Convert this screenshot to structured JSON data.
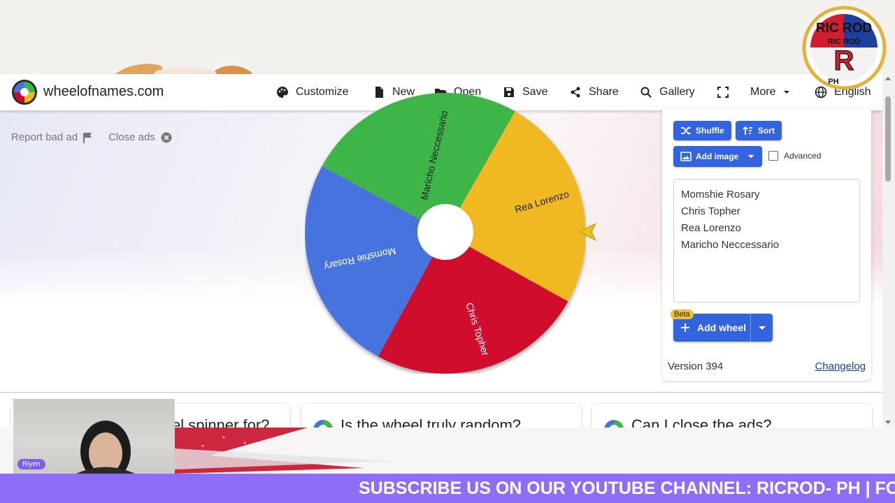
{
  "site": {
    "title": "wheelofnames.com"
  },
  "nav": {
    "customize": "Customize",
    "new": "New",
    "open": "Open",
    "save": "Save",
    "share": "Share",
    "gallery": "Gallery",
    "more": "More",
    "language": "English"
  },
  "ads": {
    "report": "Report bad ad",
    "close": "Close ads"
  },
  "wheel": {
    "segments": [
      {
        "label": "Maricho Neccessario",
        "color": "#3db54a"
      },
      {
        "label": "Rea Lorenzo",
        "color": "#f0b923"
      },
      {
        "label": "Chris Topher",
        "color": "#d1072f"
      },
      {
        "label": "Momshie Rosary",
        "color": "#4773de"
      }
    ]
  },
  "panel": {
    "shuffle": "Shuffle",
    "sort": "Sort",
    "add_image": "Add image",
    "advanced": "Advanced",
    "names": [
      "Momshie Rosary",
      "Chris Topher",
      "Rea Lorenzo",
      "Maricho Neccessario"
    ],
    "beta": "Beta",
    "add_wheel": "Add wheel",
    "version": "Version 394",
    "changelog": "Changelog"
  },
  "faq": [
    "el spinner for?",
    "Is the wheel truly random?",
    "Can I close the ads?"
  ],
  "overlay": {
    "cam_name": "Riyen",
    "ticker": "SUBSCRIBE US ON OUR YOUTUBE CHANNEL: RICROD- PH | FO",
    "badge_top": "RIC ROD",
    "badge_mid": "RIC ROD",
    "badge_letters": "R",
    "badge_bottom": "PH"
  }
}
